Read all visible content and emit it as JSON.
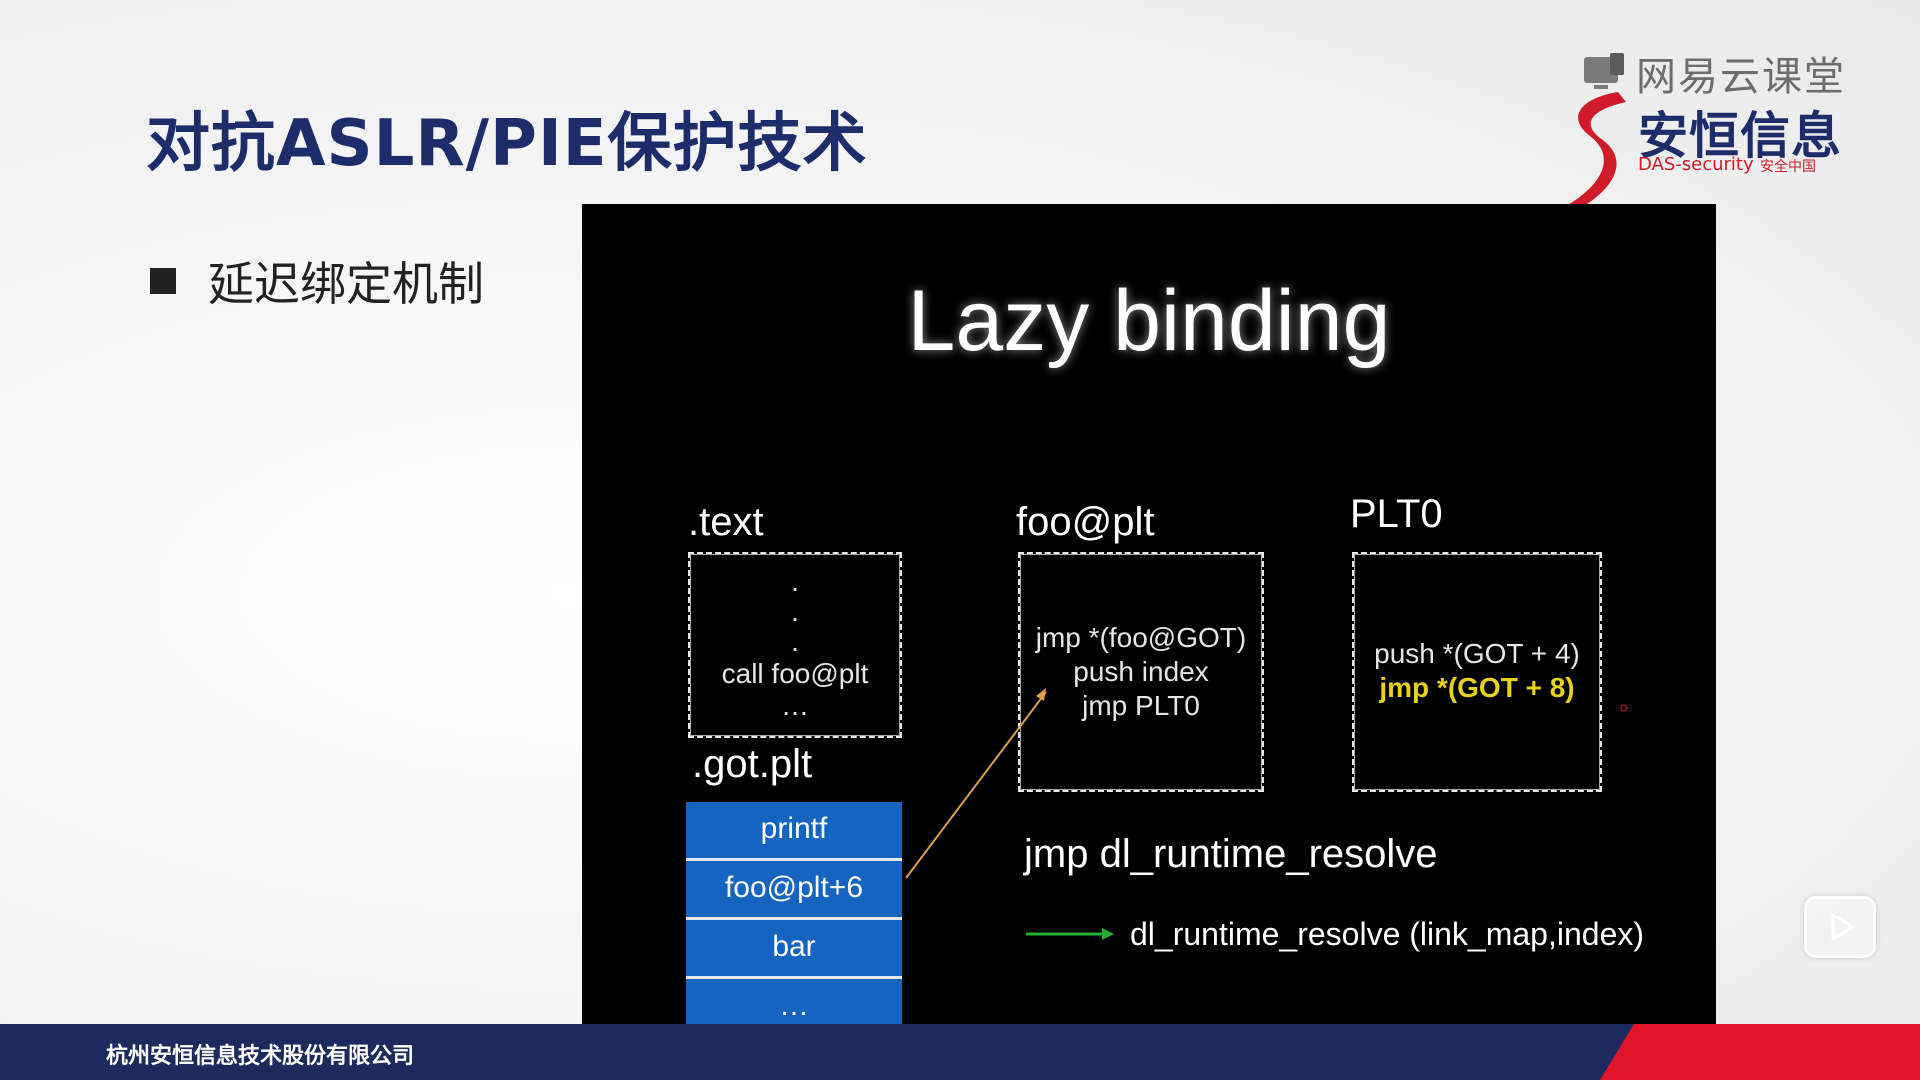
{
  "header": {
    "title": "对抗ASLR/PIE保护技术",
    "bullet": "延迟绑定机制"
  },
  "logo": {
    "platform": "网易云课堂",
    "brand": "安恒信息",
    "sub_en": "DAS-security",
    "sub_cn": "安全中国",
    "icon": "cloud-monitor-icon"
  },
  "slide": {
    "title": "Lazy binding",
    "text_label": ".text",
    "text_box": {
      "dots": [
        ".",
        ".",
        "."
      ],
      "call": "call foo@plt",
      "ellipsis": "…"
    },
    "foo_label": "foo@plt",
    "foo_box": [
      "jmp *(foo@GOT)",
      "push index",
      "jmp PLT0"
    ],
    "plt0_label": "PLT0",
    "plt0_box": {
      "line1": "push *(GOT + 4)",
      "line2": "jmp *(GOT + 8)"
    },
    "got_label": ".got.plt",
    "got_cells": [
      "printf",
      "foo@plt+6",
      "bar",
      "…"
    ],
    "resolve": "jmp dl_runtime_resolve",
    "resolve_call": "dl_runtime_resolve (link_map,index)",
    "colors": {
      "got_cell": "#1564c0",
      "highlight": "#e6d11c",
      "arrow_orange": "#d9a050",
      "arrow_green": "#22b032"
    }
  },
  "footer": {
    "company": "杭州安恒信息技术股份有限公司",
    "colors": {
      "navy": "#1d2a5e",
      "red": "#e0142b"
    }
  },
  "player": {
    "icon": "play-icon"
  }
}
